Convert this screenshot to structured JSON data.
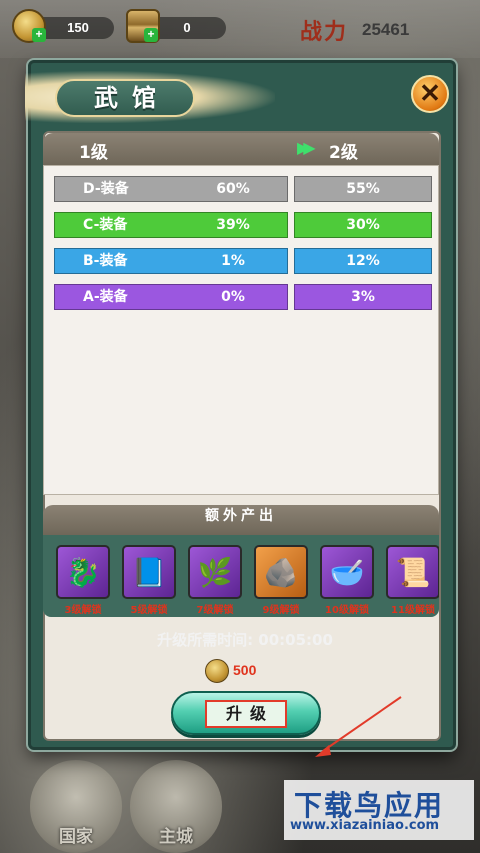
{
  "topbar": {
    "gold_value": "150",
    "token_value": "0",
    "power_label": "战力",
    "power_value": "25461"
  },
  "modal": {
    "title": "武馆",
    "close_icon": "close-x-icon",
    "current_level": "1级",
    "next_level": "2级",
    "rates": [
      {
        "grade": "D-装备",
        "current": "60%",
        "next": "55%",
        "color": "#a5a5a5"
      },
      {
        "grade": "C-装备",
        "current": "39%",
        "next": "30%",
        "color": "#4ecb3a"
      },
      {
        "grade": "B-装备",
        "current": "1%",
        "next": "12%",
        "color": "#3aa6e6"
      },
      {
        "grade": "A-装备",
        "current": "0%",
        "next": "3%",
        "color": "#9b57e0"
      }
    ],
    "extra_title": "额外产出",
    "extra_items": [
      {
        "icon": "jade-beast-icon",
        "unlock": "3级解锁"
      },
      {
        "icon": "book-icon",
        "unlock": "5级解锁"
      },
      {
        "icon": "herb-icon",
        "unlock": "7级解锁"
      },
      {
        "icon": "stone-icon",
        "unlock": "9级解锁"
      },
      {
        "icon": "bowl-icon",
        "unlock": "10级解锁"
      },
      {
        "icon": "scroll-icon",
        "unlock": "11级解锁"
      }
    ],
    "time_label": "升级所需时间:",
    "time_value": "00:05:00",
    "cost_value": "500",
    "upgrade_label": "升级"
  },
  "nav": {
    "items": [
      "国家",
      "主城"
    ]
  },
  "watermark": {
    "main": "下载鸟应用",
    "url": "www.xiazainiao.com"
  }
}
